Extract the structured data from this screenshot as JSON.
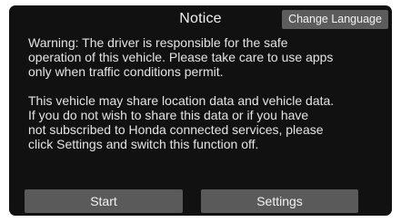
{
  "dialog": {
    "title": "Notice",
    "change_language_label": "Change Language",
    "paragraph1_lines": [
      "Warning: The driver is responsible for the safe",
      "operation of this vehicle. Please take care to use apps",
      "only when traffic conditions permit."
    ],
    "paragraph2_lines": [
      "This vehicle may share location data and vehicle data.",
      "If you do not wish to share this data or if you have",
      "not subscribed to Honda connected services, please",
      "click Settings and switch this function off."
    ],
    "start_label": "Start",
    "settings_label": "Settings"
  },
  "colors": {
    "background": "#111111",
    "button": "#5a5a5a",
    "text": "#e8e8e8"
  }
}
